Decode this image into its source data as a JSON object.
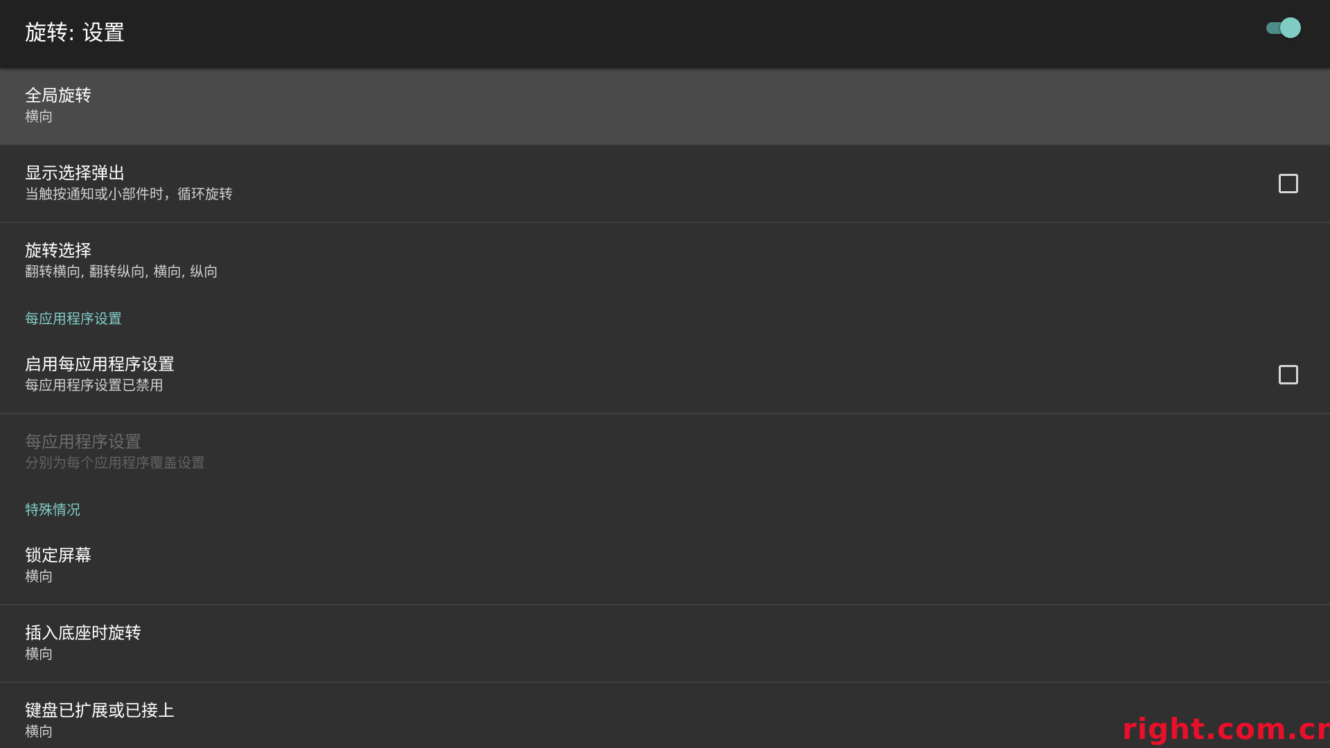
{
  "app_bar": {
    "title": "旋转: 设置",
    "master_switch": "on",
    "accent_color": "#80cbc4"
  },
  "preferences": [
    {
      "title": "全局旋转",
      "summary": "横向",
      "selected": true
    },
    {
      "title": "显示选择弹出",
      "summary": "当触按通知或小部件时，循环旋转",
      "checkbox": "unchecked"
    },
    {
      "title": "旋转选择",
      "summary": "翻转横向, 翻转纵向, 横向, 纵向"
    }
  ],
  "category_per_app": {
    "label": "每应用程序设置",
    "items": [
      {
        "title": "启用每应用程序设置",
        "summary": "每应用程序设置已禁用",
        "checkbox": "unchecked"
      },
      {
        "title": "每应用程序设置",
        "summary": "分别为每个应用程序覆盖设置",
        "enabled": false
      }
    ]
  },
  "category_special": {
    "label": "特殊情况",
    "items": [
      {
        "title": "锁定屏幕",
        "summary": "横向"
      },
      {
        "title": "插入底座时旋转",
        "summary": "横向"
      },
      {
        "title": "键盘已扩展或已接上",
        "summary": "横向"
      }
    ]
  },
  "watermark": "right.com.cn"
}
